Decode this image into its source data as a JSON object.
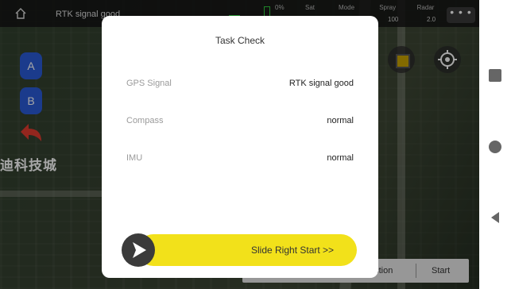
{
  "topbar": {
    "status": "RTK signal good",
    "battery_pct": "0%",
    "sat_label": "Sat",
    "mode_label": "Mode",
    "spray_label": "Spray",
    "spray_value": "100",
    "radar_label": "Radar",
    "radar_value": "2.0",
    "more_label": "• • •"
  },
  "map": {
    "a_button": "A",
    "b_button": "B",
    "place_label": "迪科技城"
  },
  "bottom_bar": {
    "left_label": "ection",
    "start_label": "Start"
  },
  "modal": {
    "title": "Task Check",
    "rows": [
      {
        "label": "GPS Signal",
        "value": "RTK signal good"
      },
      {
        "label": "Compass",
        "value": "normal"
      },
      {
        "label": "IMU",
        "value": "normal"
      }
    ],
    "slider_label": "Slide Right Start >>"
  },
  "colors": {
    "accent_yellow": "#f2e11a",
    "ab_blue": "#2a5bd7",
    "modal_bg": "#ffffff"
  }
}
